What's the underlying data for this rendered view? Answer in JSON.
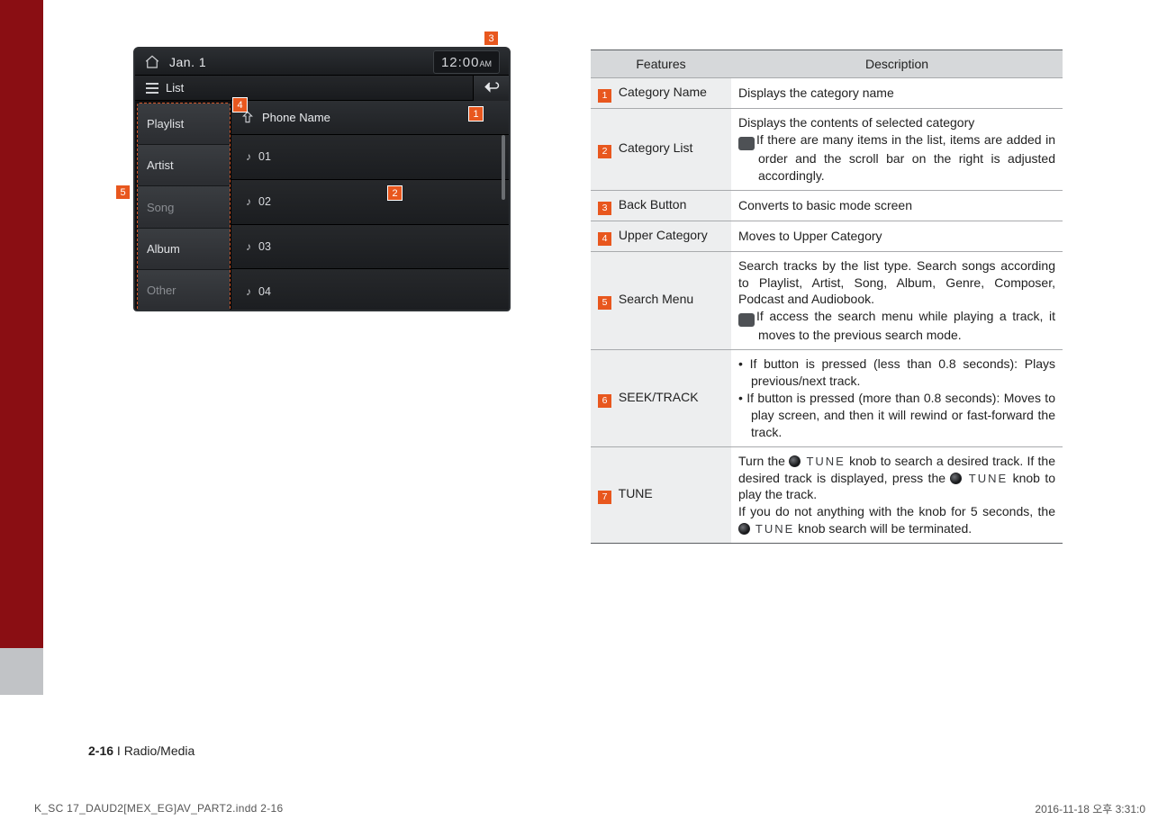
{
  "screenshot": {
    "status": {
      "date": "Jan.  1",
      "time": "12:00",
      "ampm": "AM"
    },
    "subbar": {
      "list_label": "List"
    },
    "categories": [
      "Playlist",
      "Artist",
      "Song",
      "Album",
      "Other"
    ],
    "heading": "Phone Name",
    "tracks": [
      "01",
      "02",
      "03",
      "04"
    ]
  },
  "callouts": {
    "c1": "1",
    "c2": "2",
    "c3": "3",
    "c4": "4",
    "c5": "5"
  },
  "table": {
    "headers": {
      "features": "Features",
      "description": "Description"
    },
    "rows": [
      {
        "num": "1",
        "feature": "Category Name",
        "desc": "Displays the category name"
      },
      {
        "num": "2",
        "feature": "Category List",
        "desc_main": "Displays the contents of selected category",
        "info": "If there are many items in the list, items are added in order and the scroll bar on the right is adjusted accordingly."
      },
      {
        "num": "3",
        "feature": "Back Button",
        "desc": "Converts to basic mode screen"
      },
      {
        "num": "4",
        "feature": "Upper Category",
        "desc": "Moves to Upper Category"
      },
      {
        "num": "5",
        "feature": "Search Menu",
        "desc_main": "Search tracks by the list type. Search songs according to Playlist, Artist, Song, Album, Genre, Composer, Podcast and Audiobook.",
        "info": "If access the search menu while playing a track, it moves to the previous search mode."
      },
      {
        "num": "6",
        "feature": "SEEK/TRACK",
        "bullets": [
          "If button is pressed (less than 0.8 seconds): Plays previous/next track.",
          "If button is pressed (more than 0.8 seconds): Moves to play screen, and then it will rewind or fast-forward the track."
        ]
      },
      {
        "num": "7",
        "feature": "TUNE",
        "tune": {
          "a": "Turn the ",
          "b": " knob to search a desired track. If the desired track is displayed, press the ",
          "c": " knob to play the track.",
          "d": "If you do not anything with the knob for 5 seconds, the ",
          "e": " knob search will be terminated.",
          "label": "TUNE"
        }
      }
    ]
  },
  "page_ref": {
    "num": "2-16",
    "section": " I Radio/Media"
  },
  "footer": {
    "left": "K_SC 17_DAUD2[MEX_EG]AV_PART2.indd   2-16",
    "right": "2016-11-18   오후 3:31:0"
  }
}
